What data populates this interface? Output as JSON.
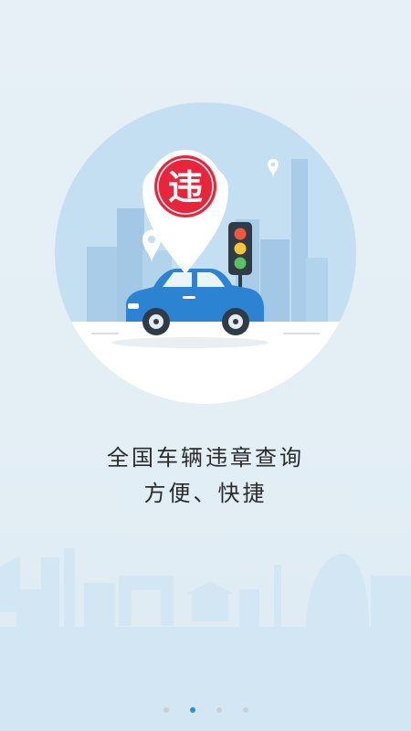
{
  "badge": {
    "text": "违"
  },
  "tagline": {
    "line1": "全国车辆违章查询",
    "line2": "方便、快捷"
  },
  "pager": {
    "page_count": 4,
    "active_index": 1
  },
  "colors": {
    "circle": "#c4def1",
    "building": "#a9cce8",
    "car_body": "#2c83d1",
    "badge_red": "#e8253b",
    "skyline": "#cfe3f1"
  }
}
